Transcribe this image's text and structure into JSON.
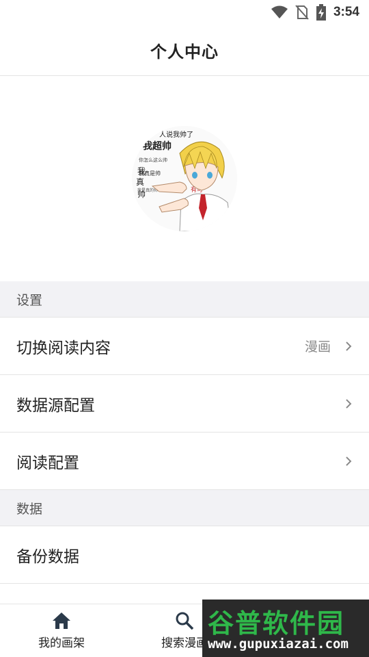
{
  "status_bar": {
    "time": "3:54"
  },
  "header": {
    "title": "个人中心"
  },
  "avatar": {
    "words": [
      "人说我帅了",
      "我超帅",
      "我真是帅",
      "你怎么这么帅",
      "我是真的帅",
      "我",
      "真",
      "帅",
      "有可"
    ]
  },
  "sections": [
    {
      "title": "设置"
    },
    {
      "title": "数据"
    }
  ],
  "settings_items": [
    {
      "label": "切换阅读内容",
      "value": "漫画"
    },
    {
      "label": "数据源配置",
      "value": ""
    },
    {
      "label": "阅读配置",
      "value": ""
    }
  ],
  "data_items": [
    {
      "label": "备份数据"
    }
  ],
  "bottom_nav": {
    "items": [
      {
        "label": "我的画架",
        "icon": "home-icon"
      },
      {
        "label": "搜索漫画",
        "icon": "search-icon"
      }
    ]
  },
  "watermark": {
    "title": "谷普软件园",
    "url": "www.gupuxiazai.com"
  }
}
